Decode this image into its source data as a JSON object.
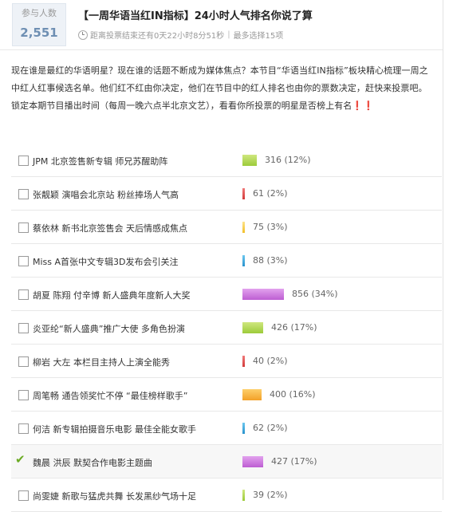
{
  "participants": {
    "label": "参与人数",
    "count": "2,551"
  },
  "poll": {
    "title": "【一周华语当红IN指标】24小时人气排名你说了算",
    "countdown": "距离投票结束还有0天22小时8分51秒",
    "max_choices": "最多选择15项"
  },
  "description": "现在谁是最红的华语明星？现在谁的话题不断成为媒体焦点？本节目“华语当红IN指标”板块精心梳理一周之中红人红事候选名单。他们红不红由你决定，他们在节目中的红人排名也由你的票数决定，赶快来投票吧。锁定本期节目播出时间（每周一晚六点半北京文艺），看看你所投票的明星是否榜上有名❗❗",
  "options": [
    {
      "label": "JPM 北京签售新专辑  师兄苏醒助阵",
      "votes": "316",
      "percent": "(12%)",
      "share": 12,
      "color": "green",
      "selected": false
    },
    {
      "label": "张靓颖  演唱会北京站  粉丝捧场人气高",
      "votes": "61",
      "percent": "(2%)",
      "share": 2,
      "color": "red",
      "selected": false
    },
    {
      "label": "蔡依林  新书北京签售会  天后情感成焦点",
      "votes": "75",
      "percent": "(3%)",
      "share": 3,
      "color": "yellow",
      "selected": false
    },
    {
      "label": "Miss A首张中文专辑3D发布会引关注",
      "votes": "88",
      "percent": "(3%)",
      "share": 3,
      "color": "blue",
      "selected": false
    },
    {
      "label": "胡夏  陈翔  付辛博  新人盛典年度新人大奖",
      "votes": "856",
      "percent": "(34%)",
      "share": 34,
      "color": "purple",
      "selected": false
    },
    {
      "label": "炎亚纶“新人盛典”推广大使  多角色扮演",
      "votes": "426",
      "percent": "(17%)",
      "share": 17,
      "color": "green",
      "selected": false
    },
    {
      "label": "柳岩  大左  本栏目主持人上演全能秀",
      "votes": "40",
      "percent": "(2%)",
      "share": 2,
      "color": "red",
      "selected": false
    },
    {
      "label": "周笔畅  通告领奖忙不停  “最佳榜样歌手”",
      "votes": "400",
      "percent": "(16%)",
      "share": 16,
      "color": "orange",
      "selected": false
    },
    {
      "label": "何洁  新专辑拍摄音乐电影  最佳全能女歌手",
      "votes": "62",
      "percent": "(2%)",
      "share": 2,
      "color": "blue",
      "selected": false
    },
    {
      "label": "魏晨  洪辰  默契合作电影主题曲",
      "votes": "427",
      "percent": "(17%)",
      "share": 17,
      "color": "purple",
      "selected": true
    },
    {
      "label": "尚雯婕  新歌与猛虎共舞  长发黑纱气场十足",
      "votes": "39",
      "percent": "(2%)",
      "share": 2,
      "color": "green",
      "selected": false
    }
  ],
  "colors": {
    "green": "#9ccb3a",
    "red": "#d23a3a",
    "yellow": "#f2bf2a",
    "blue": "#2a93cd",
    "purple": "#bd5ed2",
    "orange": "#f3a128",
    "count_accent": "#6e8fb3",
    "check": "#6bab24"
  },
  "icons": {
    "countdown": "clock-icon",
    "selected": "checkmark-icon"
  }
}
